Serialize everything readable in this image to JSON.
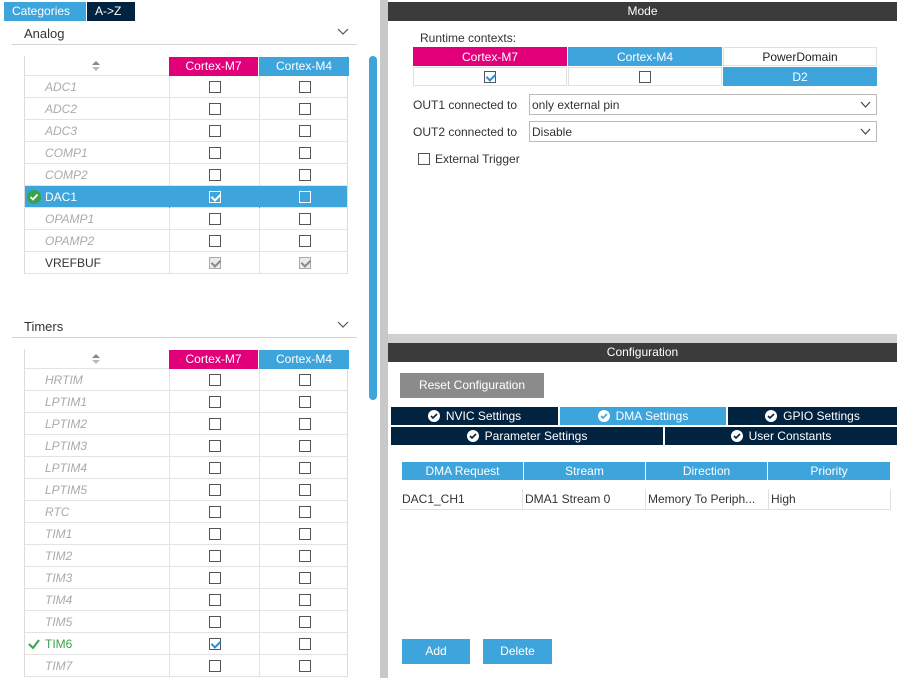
{
  "tabs": {
    "categories": "Categories",
    "az": "A->Z"
  },
  "analog": {
    "title": "Analog",
    "col_m7": "Cortex-M7",
    "col_m4": "Cortex-M4",
    "rows": [
      {
        "name": "ADC1",
        "m7": false,
        "m4": false
      },
      {
        "name": "ADC2",
        "m7": false,
        "m4": false
      },
      {
        "name": "ADC3",
        "m7": false,
        "m4": false
      },
      {
        "name": "COMP1",
        "m7": false,
        "m4": false
      },
      {
        "name": "COMP2",
        "m7": false,
        "m4": false
      },
      {
        "name": "DAC1",
        "m7": true,
        "m4": false
      },
      {
        "name": "OPAMP1",
        "m7": false,
        "m4": false
      },
      {
        "name": "OPAMP2",
        "m7": false,
        "m4": false
      },
      {
        "name": "VREFBUF",
        "m7": true,
        "m4": true
      }
    ]
  },
  "timers": {
    "title": "Timers",
    "col_m7": "Cortex-M7",
    "col_m4": "Cortex-M4",
    "rows": [
      {
        "name": "HRTIM"
      },
      {
        "name": "LPTIM1"
      },
      {
        "name": "LPTIM2"
      },
      {
        "name": "LPTIM3"
      },
      {
        "name": "LPTIM4"
      },
      {
        "name": "LPTIM5"
      },
      {
        "name": "RTC"
      },
      {
        "name": "TIM1"
      },
      {
        "name": "TIM2"
      },
      {
        "name": "TIM3"
      },
      {
        "name": "TIM4"
      },
      {
        "name": "TIM5"
      },
      {
        "name": "TIM6"
      },
      {
        "name": "TIM7"
      }
    ]
  },
  "mode": {
    "title": "Mode",
    "runtime_label": "Runtime contexts:",
    "ctx_m7": "Cortex-M7",
    "ctx_m4": "Cortex-M4",
    "ctx_power": "PowerDomain",
    "power_value": "D2",
    "out1_label": "OUT1 connected to",
    "out1_value": "only external pin",
    "out2_label": "OUT2 connected to",
    "out2_value": "Disable",
    "ext_trigger": "External Trigger"
  },
  "config": {
    "title": "Configuration",
    "reset_button": "Reset Configuration",
    "tab_nvic": "NVIC Settings",
    "tab_dma": "DMA Settings",
    "tab_gpio": "GPIO Settings",
    "tab_param": "Parameter Settings",
    "tab_user": "User Constants",
    "dma_headers": [
      "DMA Request",
      "Stream",
      "Direction",
      "Priority"
    ],
    "dma_row": [
      "DAC1_CH1",
      "DMA1 Stream 0",
      "Memory To Periph...",
      "High"
    ],
    "add_button": "Add",
    "delete_button": "Delete"
  },
  "colors": {
    "accent": "#3ea4dc",
    "m7": "#e2007a",
    "navy": "#02233f",
    "ok": "#3aa24a"
  }
}
